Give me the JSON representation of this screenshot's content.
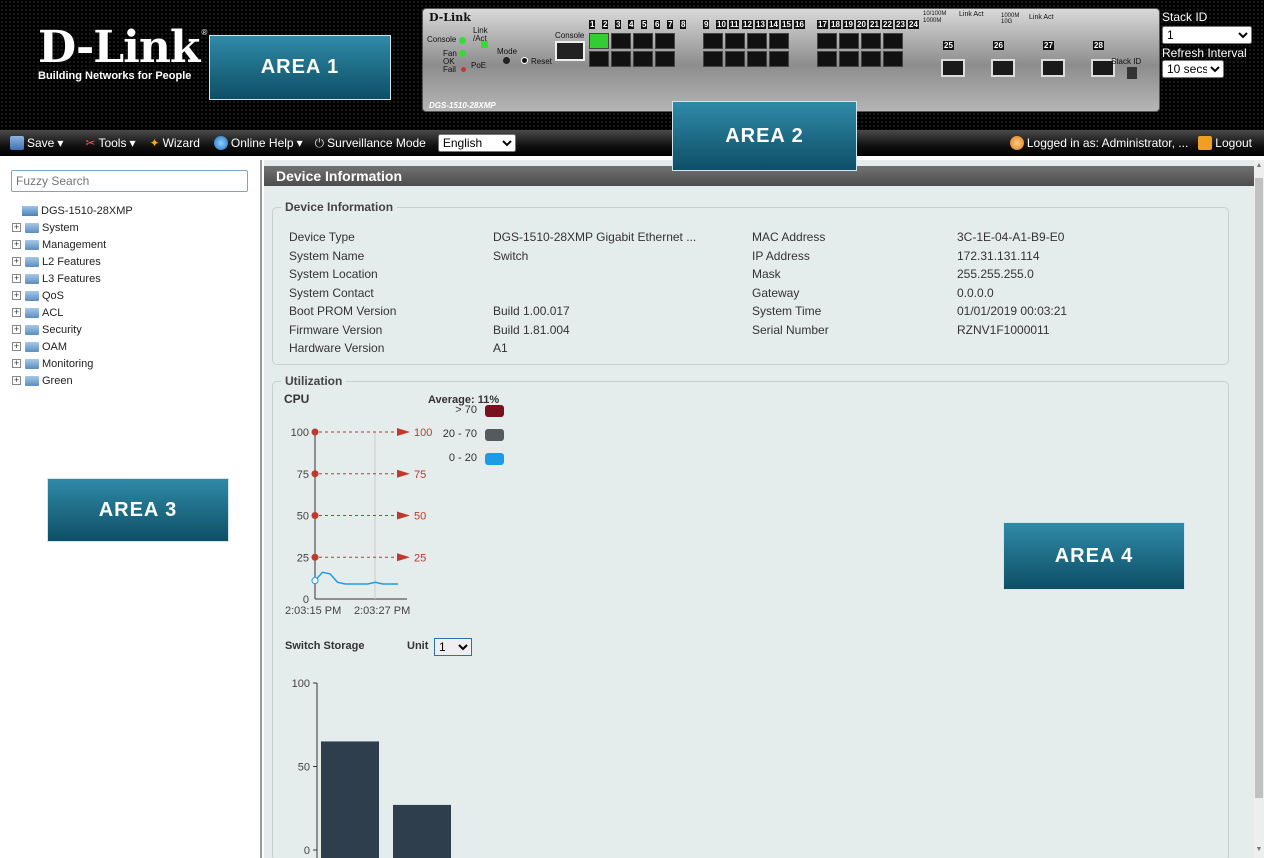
{
  "header": {
    "logo_text": "D-Link",
    "logo_tagline": "Building Networks for People",
    "panel": {
      "brand": "D-Link",
      "model": "DGS-1510-28XMP",
      "console_label": "Console",
      "link_act_label": "Link /Act",
      "fan_label": "Fan",
      "ok_label": "OK",
      "fail_label": "Fail",
      "poe_label": "PoE",
      "mode_label": "Mode",
      "reset_label": "Reset",
      "console_port_label": "Console",
      "speed_legend_1": "10/100M 1000M",
      "speed_legend_2": "Link Act",
      "speed_legend_3": "1000M 10G",
      "speed_legend_4": "Link Act",
      "stack_id_label": "Stack ID",
      "ports_group1": [
        "1",
        "2",
        "3",
        "4",
        "5",
        "6",
        "7",
        "8"
      ],
      "ports_group2": [
        "9",
        "10",
        "11",
        "12",
        "13",
        "14",
        "15",
        "16"
      ],
      "ports_group3": [
        "17",
        "18",
        "19",
        "20",
        "21",
        "22",
        "23",
        "24"
      ],
      "sfp_ports": [
        "25",
        "26",
        "27",
        "28"
      ]
    },
    "stack_id_label": "Stack ID",
    "stack_id_value": "1",
    "refresh_label": "Refresh Interval",
    "refresh_value": "10 secs"
  },
  "areas": [
    "AREA 1",
    "AREA 2",
    "AREA 3",
    "AREA 4"
  ],
  "toolbar": {
    "save": "Save",
    "tools": "Tools",
    "wizard": "Wizard",
    "help": "Online Help",
    "surveillance": "Surveillance Mode",
    "language": "English",
    "logged_in": "Logged in as: Administrator, ...",
    "logout": "Logout"
  },
  "sidebar": {
    "search_placeholder": "Fuzzy Search",
    "root": "DGS-1510-28XMP",
    "items": [
      "System",
      "Management",
      "L2 Features",
      "L3 Features",
      "QoS",
      "ACL",
      "Security",
      "OAM",
      "Monitoring",
      "Green"
    ]
  },
  "main": {
    "title": "Device Information",
    "device_info_legend": "Device Information",
    "left_labels": [
      "Device Type",
      "System Name",
      "System Location",
      "System Contact",
      "Boot PROM Version",
      "Firmware Version",
      "Hardware Version"
    ],
    "left_values": [
      "DGS-1510-28XMP Gigabit Ethernet ...",
      "Switch",
      "",
      "",
      "Build 1.00.017",
      "Build 1.81.004",
      "A1"
    ],
    "right_labels": [
      "MAC Address",
      "IP Address",
      "Mask",
      "Gateway",
      "System Time",
      "Serial Number"
    ],
    "right_values": [
      "3C-1E-04-A1-B9-E0",
      "172.31.131.114",
      "255.255.255.0",
      "0.0.0.0",
      "01/01/2019 00:03:21",
      "RZNV1F1000011"
    ],
    "utilization_legend": "Utilization",
    "cpu_label": "CPU",
    "average_label": "Average: 11%",
    "legend_items": [
      {
        "label": "> 70",
        "color": "#7a0f1e"
      },
      {
        "label": "20 - 70",
        "color": "#555a5e"
      },
      {
        "label": "0 - 20",
        "color": "#1e9be8"
      }
    ],
    "storage_label": "Switch Storage",
    "unit_label": "Unit",
    "unit_value": "1"
  },
  "chart_data": [
    {
      "type": "line",
      "title": "CPU",
      "x": [
        "2:03:15 PM",
        "2:03:27 PM"
      ],
      "y_ticks": [
        0,
        25,
        50,
        75,
        100
      ],
      "threshold_labels": [
        100,
        75,
        50,
        25
      ],
      "series": [
        {
          "name": "",
          "values": [
            11,
            16,
            15,
            10,
            9,
            9,
            9,
            9,
            10,
            9,
            9,
            9
          ]
        }
      ],
      "ylim": [
        0,
        100
      ],
      "color": "#1e9be8"
    },
    {
      "type": "bar",
      "title": "Switch Storage",
      "categories": [
        "",
        ""
      ],
      "values": [
        65,
        27
      ],
      "y_ticks": [
        0,
        50,
        100
      ],
      "ylim": [
        0,
        100
      ],
      "color": "#2f3e4c"
    }
  ]
}
